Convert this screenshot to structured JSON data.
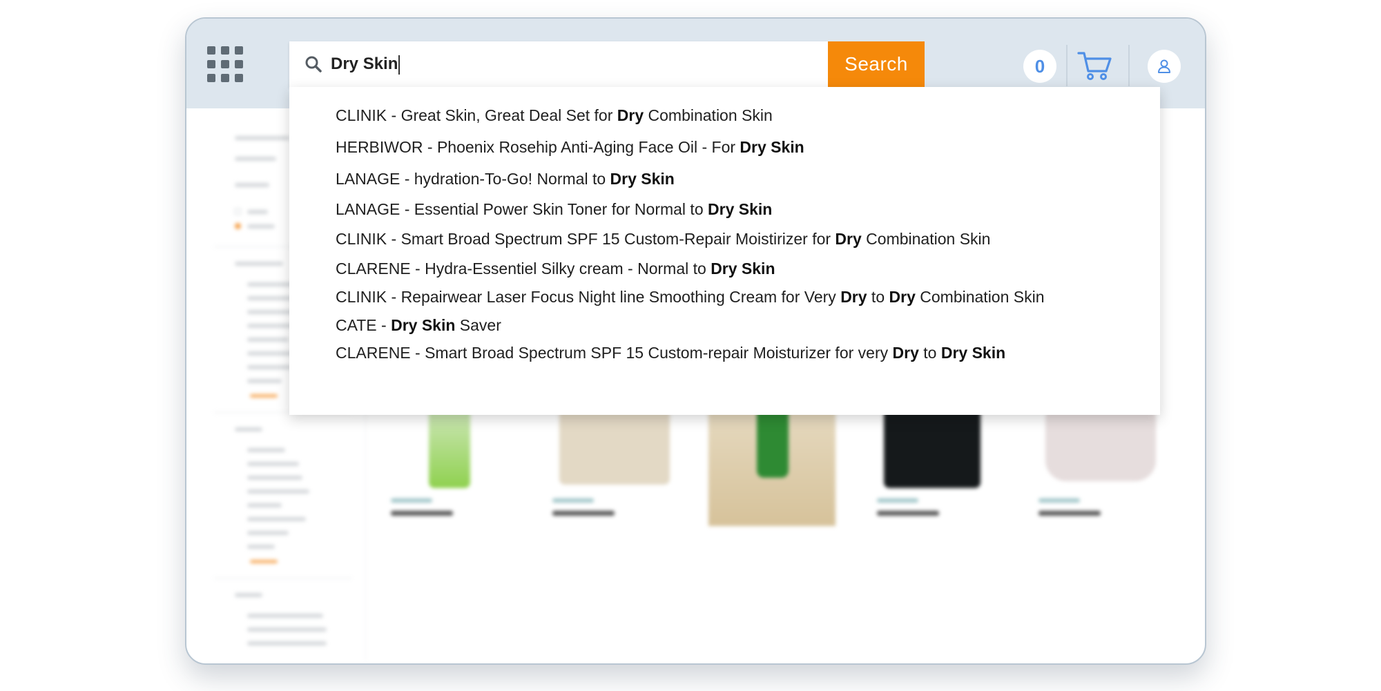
{
  "header": {
    "cart_count": "0",
    "icons": [
      "apps-grid-icon",
      "search-icon",
      "cart-icon",
      "user-icon"
    ]
  },
  "search": {
    "query": "Dry Skin",
    "button_label": "Search"
  },
  "suggestions": [
    {
      "parts": [
        {
          "t": "CLINIK - Great Skin, Great Deal Set for ",
          "b": false
        },
        {
          "t": "Dry",
          "b": true
        },
        {
          "t": " Combination Skin",
          "b": false
        }
      ]
    },
    {
      "parts": [
        {
          "t": "HERBIWOR - Phoenix Rosehip Anti-Aging Face Oil - For ",
          "b": false
        },
        {
          "t": "Dry Skin",
          "b": true
        }
      ]
    },
    {
      "parts": [
        {
          "t": "LANAGE - hydration-To-Go! Normal to ",
          "b": false
        },
        {
          "t": "Dry Skin",
          "b": true
        }
      ]
    },
    {
      "parts": [
        {
          "t": "LANAGE - Essential Power Skin Toner for Normal to ",
          "b": false
        },
        {
          "t": "Dry Skin",
          "b": true
        }
      ]
    },
    {
      "parts": [
        {
          "t": "CLINIK - Smart Broad Spectrum SPF 15 Custom-Repair Moistirizer for ",
          "b": false
        },
        {
          "t": "Dry",
          "b": true
        },
        {
          "t": " Combination Skin",
          "b": false
        }
      ]
    },
    {
      "parts": [
        {
          "t": "CLARENE - Hydra-Essentiel Silky cream - Normal to ",
          "b": false
        },
        {
          "t": "Dry Skin",
          "b": true
        }
      ]
    },
    {
      "parts": [
        {
          "t": "CLINIK - Repairwear Laser Focus Night line Smoothing Cream for Very ",
          "b": false
        },
        {
          "t": "Dry",
          "b": true
        },
        {
          "t": " to ",
          "b": false
        },
        {
          "t": "Dry",
          "b": true
        },
        {
          "t": " Combination Skin",
          "b": false
        }
      ]
    },
    {
      "parts": [
        {
          "t": "CATE - ",
          "b": false
        },
        {
          "t": "Dry Skin",
          "b": true
        },
        {
          "t": " Saver",
          "b": false
        }
      ]
    },
    {
      "parts": [
        {
          "t": "CLARENE - Smart Broad Spectrum SPF 15 Custom-repair Moisturizer for very ",
          "b": false
        },
        {
          "t": "Dry",
          "b": true
        },
        {
          "t": " to ",
          "b": false
        },
        {
          "t": "Dry Skin",
          "b": true
        }
      ]
    }
  ],
  "colors": {
    "accent": "#f5890a",
    "header_bg": "#dde6ee",
    "link_blue": "#4f8fe6"
  },
  "products": [
    {
      "image_colors": [
        "#e9f0e6",
        "#8fd14f"
      ]
    },
    {
      "image_colors": [
        "#e8ddc9",
        "#c9a890"
      ]
    },
    {
      "image_colors": [
        "#d9c9a7",
        "#3e8f3a"
      ]
    },
    {
      "image_colors": [
        "#111111",
        "#2c3e40"
      ]
    },
    {
      "image_colors": [
        "#efe7e7",
        "#cdbcbc"
      ]
    }
  ]
}
